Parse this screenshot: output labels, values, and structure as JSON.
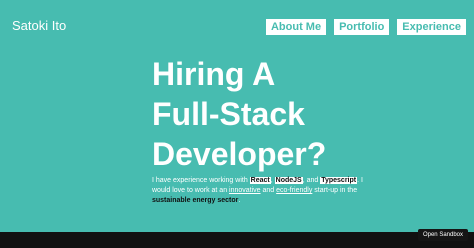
{
  "header": {
    "site_name": "Satoki Ito",
    "nav": [
      {
        "label": "About Me"
      },
      {
        "label": "Portfolio"
      },
      {
        "label": "Experience"
      }
    ]
  },
  "hero": {
    "title_lines": [
      "Hiring A",
      "Full-Stack",
      "Developer?"
    ],
    "intro": {
      "t1": "I have experience working with ",
      "react": "React",
      "c1": ", ",
      "nodejs": "NodeJS",
      "t2": ", and ",
      "typescript": "Typescript",
      "t3": ". I would love to work at an ",
      "innovative": "innovative",
      "t4": " and ",
      "ecofriendly": "eco-friendly",
      "t5": " start-up in the ",
      "sustainable": "sustainable energy sector",
      "t6": "."
    }
  },
  "sandbox_button": "Open Sandbox",
  "colors": {
    "accent": "#47bcb0",
    "text_light": "#ffffff",
    "text_dark": "#111111"
  }
}
